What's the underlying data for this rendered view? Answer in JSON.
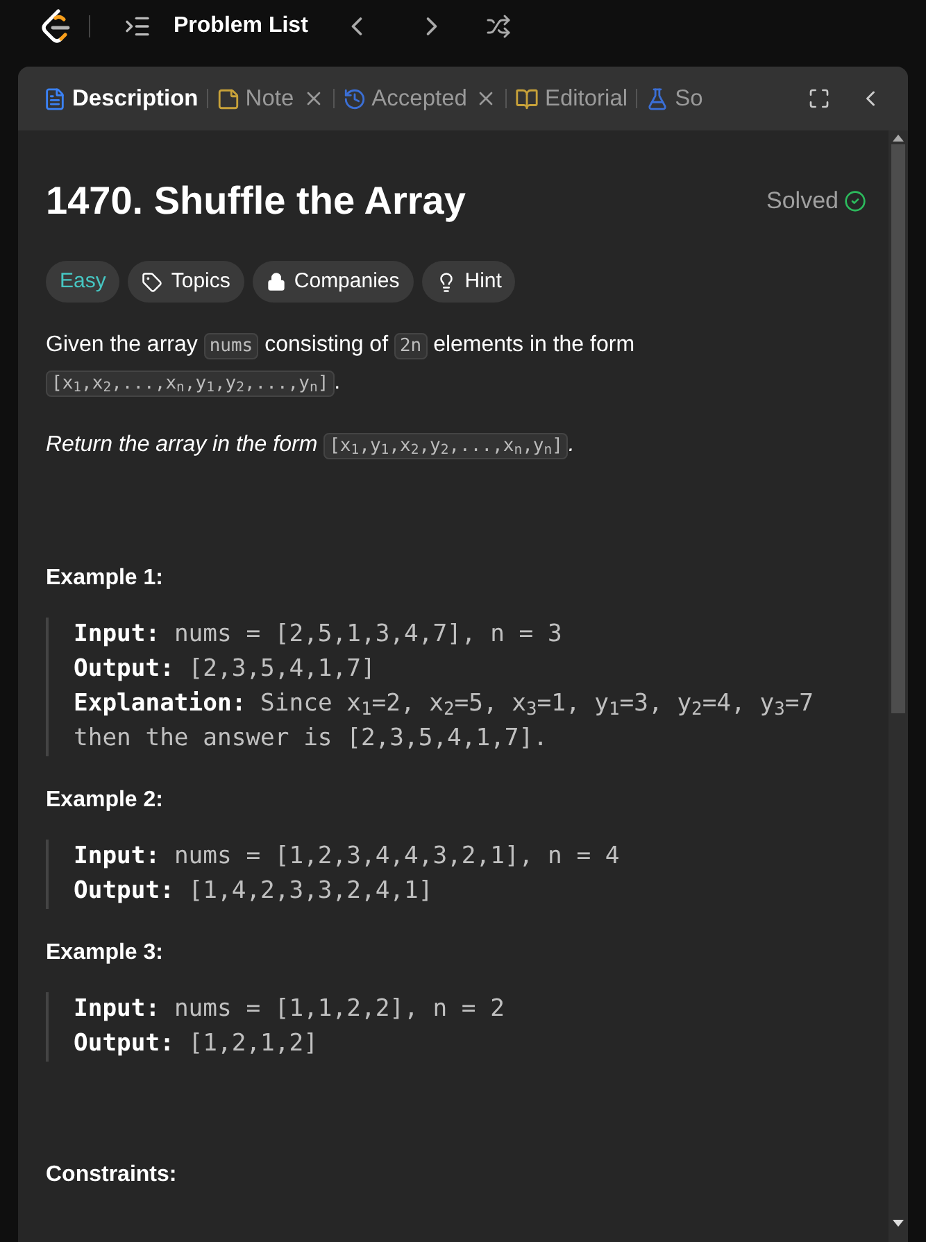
{
  "top_bar": {
    "title": "Problem List"
  },
  "tabs": [
    {
      "label": "Description",
      "kind": "description",
      "selected": true,
      "closable": false
    },
    {
      "label": "Note",
      "kind": "note",
      "selected": false,
      "closable": true
    },
    {
      "label": "Accepted",
      "kind": "accepted",
      "selected": false,
      "closable": true
    },
    {
      "label": "Editorial",
      "kind": "editorial",
      "selected": false,
      "closable": false
    },
    {
      "label": "So",
      "kind": "solutions",
      "selected": false,
      "closable": false
    }
  ],
  "problem": {
    "title": "1470. Shuffle the Array",
    "status": "Solved",
    "tags": [
      {
        "label": "Easy",
        "kind": "difficulty"
      },
      {
        "label": "Topics",
        "kind": "topics"
      },
      {
        "label": "Companies",
        "kind": "companies"
      },
      {
        "label": "Hint",
        "kind": "hint"
      }
    ],
    "paragraphs": [
      {
        "italic": false,
        "segments": [
          {
            "kind": "text",
            "text": "Given the array "
          },
          {
            "kind": "code",
            "text": "nums"
          },
          {
            "kind": "text",
            "text": " consisting of "
          },
          {
            "kind": "code",
            "text": "2n"
          },
          {
            "kind": "text",
            "text": " elements in the form "
          },
          {
            "kind": "code",
            "text": "[x$_{1}$,x$_{2}$,...,x$_{n}$,y$_{1}$,y$_{2}$,...,y$_{n}$]"
          },
          {
            "kind": "text",
            "text": "."
          }
        ]
      },
      {
        "italic": true,
        "segments": [
          {
            "kind": "text",
            "text": "Return the array in the form "
          },
          {
            "kind": "code",
            "text": "[x$_{1}$,y$_{1}$,x$_{2}$,y$_{2}$,...,x$_{n}$,y$_{n}$]"
          },
          {
            "kind": "text",
            "text": "."
          }
        ]
      }
    ],
    "examples": [
      {
        "title": "Example 1:",
        "lines": [
          {
            "label": "Input:",
            "value": "nums = [2,5,1,3,4,7], n = 3"
          },
          {
            "label": "Output:",
            "value": "[2,3,5,4,1,7]"
          },
          {
            "label": "Explanation:",
            "value": "Since x$_{1}$=2, x$_{2}$=5, x$_{3}$=1, y$_{1}$=3, y$_{2}$=4, y$_{3}$=7 then the answer is [2,3,5,4,1,7]."
          }
        ]
      },
      {
        "title": "Example 2:",
        "lines": [
          {
            "label": "Input:",
            "value": "nums = [1,2,3,4,4,3,2,1], n = 4"
          },
          {
            "label": "Output:",
            "value": "[1,4,2,3,3,2,4,1]"
          }
        ]
      },
      {
        "title": "Example 3:",
        "lines": [
          {
            "label": "Input:",
            "value": "nums = [1,1,2,2], n = 2"
          },
          {
            "label": "Output:",
            "value": "[1,2,1,2]"
          }
        ]
      }
    ],
    "constraints_title": "Constraints:"
  }
}
